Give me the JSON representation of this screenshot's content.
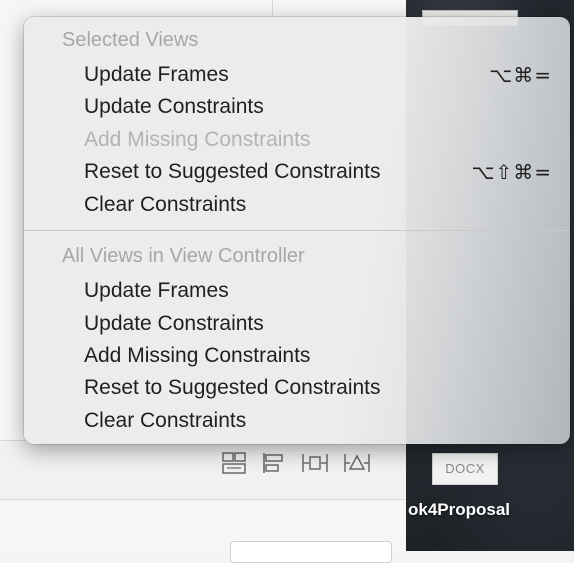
{
  "menu": {
    "sections": [
      {
        "header": "Selected Views",
        "items": [
          {
            "label": "Update Frames",
            "shortcut": "⌥⌘=",
            "enabled": true
          },
          {
            "label": "Update Constraints",
            "shortcut": "",
            "enabled": true
          },
          {
            "label": "Add Missing Constraints",
            "shortcut": "",
            "enabled": false
          },
          {
            "label": "Reset to Suggested Constraints",
            "shortcut": "⌥⇧⌘=",
            "enabled": true
          },
          {
            "label": "Clear Constraints",
            "shortcut": "",
            "enabled": true
          }
        ]
      },
      {
        "header": "All Views in View Controller",
        "items": [
          {
            "label": "Update Frames",
            "enabled": true
          },
          {
            "label": "Update Constraints",
            "enabled": true
          },
          {
            "label": "Add Missing Constraints",
            "enabled": true
          },
          {
            "label": "Reset to Suggested Constraints",
            "enabled": true
          },
          {
            "label": "Clear Constraints",
            "enabled": true
          }
        ]
      }
    ]
  },
  "toolbar": {
    "icons": [
      "stack-icon",
      "align-icon",
      "pin-icon",
      "resolve-issues-icon"
    ]
  },
  "desktop": {
    "file_badge": "DOCX",
    "file_label": "ok4Proposal"
  },
  "colors": {
    "menu_text": "#1f1f1f",
    "disabled_text": "#b3b3b3",
    "header_text": "#a7a7a7"
  }
}
